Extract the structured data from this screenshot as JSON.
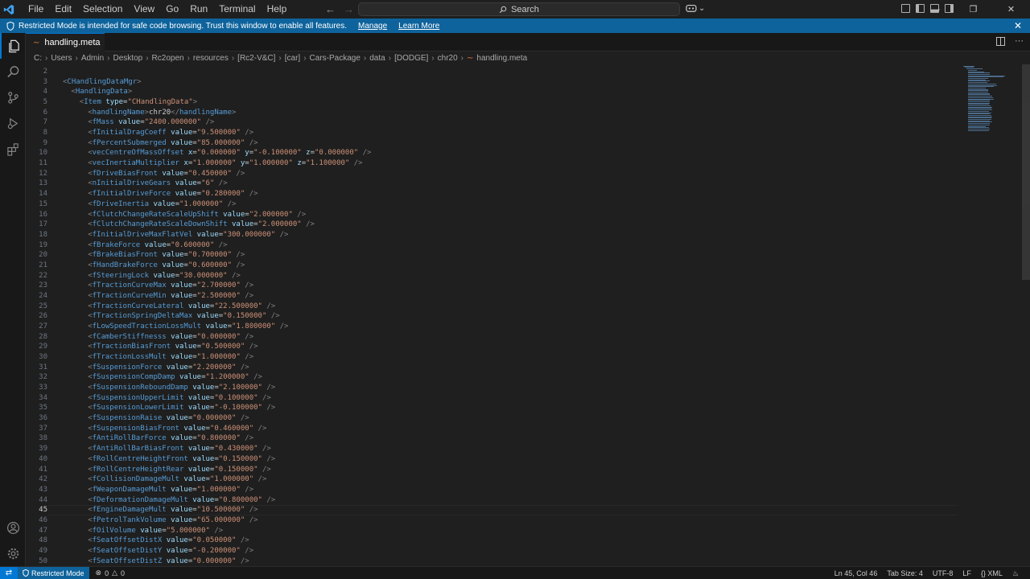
{
  "titlebar": {
    "menu": [
      "File",
      "Edit",
      "Selection",
      "View",
      "Go",
      "Run",
      "Terminal",
      "Help"
    ],
    "search_label": "Search"
  },
  "banner": {
    "message": "Restricted Mode is intended for safe code browsing. Trust this window to enable all features.",
    "manage": "Manage",
    "learn_more": "Learn More"
  },
  "tab": {
    "filename": "handling.meta"
  },
  "breadcrumb": [
    "C:",
    "Users",
    "Admin",
    "Desktop",
    "Rc2open",
    "resources",
    "[Rc2-V&C]",
    "[car]",
    "Cars-Package",
    "data",
    "[DODGE]",
    "chr20",
    "handling.meta"
  ],
  "editor": {
    "active_line": 45,
    "lines": [
      {
        "n": "2",
        "indent": 0,
        "kind": "blank"
      },
      {
        "n": "3",
        "indent": 0,
        "kind": "open",
        "tag": "CHandlingDataMgr"
      },
      {
        "n": "4",
        "indent": 1,
        "kind": "open",
        "tag": "HandlingData"
      },
      {
        "n": "5",
        "indent": 2,
        "kind": "open",
        "tag": "Item",
        "attrs": [
          [
            "type",
            "CHandlingData"
          ]
        ]
      },
      {
        "n": "6",
        "indent": 3,
        "kind": "text",
        "tag": "handlingName",
        "text": "chr20"
      },
      {
        "n": "7",
        "indent": 3,
        "kind": "self",
        "tag": "fMass",
        "attrs": [
          [
            "value",
            "2400.000000"
          ]
        ]
      },
      {
        "n": "8",
        "indent": 3,
        "kind": "self",
        "tag": "fInitialDragCoeff",
        "attrs": [
          [
            "value",
            "9.500000"
          ]
        ]
      },
      {
        "n": "9",
        "indent": 3,
        "kind": "self",
        "tag": "fPercentSubmerged",
        "attrs": [
          [
            "value",
            "85.000000"
          ]
        ]
      },
      {
        "n": "10",
        "indent": 3,
        "kind": "self",
        "tag": "vecCentreOfMassOffset",
        "attrs": [
          [
            "x",
            "0.000000"
          ],
          [
            "y",
            "-0.100000"
          ],
          [
            "z",
            "0.000000"
          ]
        ]
      },
      {
        "n": "11",
        "indent": 3,
        "kind": "self",
        "tag": "vecInertiaMultiplier",
        "attrs": [
          [
            "x",
            "1.000000"
          ],
          [
            "y",
            "1.000000"
          ],
          [
            "z",
            "1.100000"
          ]
        ]
      },
      {
        "n": "12",
        "indent": 3,
        "kind": "self",
        "tag": "fDriveBiasFront",
        "attrs": [
          [
            "value",
            "0.450000"
          ]
        ]
      },
      {
        "n": "13",
        "indent": 3,
        "kind": "self",
        "tag": "nInitialDriveGears",
        "attrs": [
          [
            "value",
            "6"
          ]
        ]
      },
      {
        "n": "14",
        "indent": 3,
        "kind": "self",
        "tag": "fInitialDriveForce",
        "attrs": [
          [
            "value",
            "0.280000"
          ]
        ]
      },
      {
        "n": "15",
        "indent": 3,
        "kind": "self",
        "tag": "fDriveInertia",
        "attrs": [
          [
            "value",
            "1.000000"
          ]
        ]
      },
      {
        "n": "16",
        "indent": 3,
        "kind": "self",
        "tag": "fClutchChangeRateScaleUpShift",
        "attrs": [
          [
            "value",
            "2.000000"
          ]
        ]
      },
      {
        "n": "17",
        "indent": 3,
        "kind": "self",
        "tag": "fClutchChangeRateScaleDownShift",
        "attrs": [
          [
            "value",
            "2.000000"
          ]
        ]
      },
      {
        "n": "18",
        "indent": 3,
        "kind": "self",
        "tag": "fInitialDriveMaxFlatVel",
        "attrs": [
          [
            "value",
            "300.000000"
          ]
        ]
      },
      {
        "n": "19",
        "indent": 3,
        "kind": "self",
        "tag": "fBrakeForce",
        "attrs": [
          [
            "value",
            "0.600000"
          ]
        ]
      },
      {
        "n": "20",
        "indent": 3,
        "kind": "self",
        "tag": "fBrakeBiasFront",
        "attrs": [
          [
            "value",
            "0.700000"
          ]
        ]
      },
      {
        "n": "21",
        "indent": 3,
        "kind": "self",
        "tag": "fHandBrakeForce",
        "attrs": [
          [
            "value",
            "0.600000"
          ]
        ]
      },
      {
        "n": "22",
        "indent": 3,
        "kind": "self",
        "tag": "fSteeringLock",
        "attrs": [
          [
            "value",
            "30.000000"
          ]
        ]
      },
      {
        "n": "23",
        "indent": 3,
        "kind": "self",
        "tag": "fTractionCurveMax",
        "attrs": [
          [
            "value",
            "2.700000"
          ]
        ]
      },
      {
        "n": "24",
        "indent": 3,
        "kind": "self",
        "tag": "fTractionCurveMin",
        "attrs": [
          [
            "value",
            "2.500000"
          ]
        ]
      },
      {
        "n": "25",
        "indent": 3,
        "kind": "self",
        "tag": "fTractionCurveLateral",
        "attrs": [
          [
            "value",
            "22.500000"
          ]
        ]
      },
      {
        "n": "26",
        "indent": 3,
        "kind": "self",
        "tag": "fTractionSpringDeltaMax",
        "attrs": [
          [
            "value",
            "0.150000"
          ]
        ]
      },
      {
        "n": "27",
        "indent": 3,
        "kind": "self",
        "tag": "fLowSpeedTractionLossMult",
        "attrs": [
          [
            "value",
            "1.800000"
          ]
        ]
      },
      {
        "n": "28",
        "indent": 3,
        "kind": "self",
        "tag": "fCamberStiffnesss",
        "attrs": [
          [
            "value",
            "0.000000"
          ]
        ]
      },
      {
        "n": "29",
        "indent": 3,
        "kind": "self",
        "tag": "fTractionBiasFront",
        "attrs": [
          [
            "value",
            "0.500000"
          ]
        ]
      },
      {
        "n": "30",
        "indent": 3,
        "kind": "self",
        "tag": "fTractionLossMult",
        "attrs": [
          [
            "value",
            "1.000000"
          ]
        ]
      },
      {
        "n": "31",
        "indent": 3,
        "kind": "self",
        "tag": "fSuspensionForce",
        "attrs": [
          [
            "value",
            "2.200000"
          ]
        ]
      },
      {
        "n": "32",
        "indent": 3,
        "kind": "self",
        "tag": "fSuspensionCompDamp",
        "attrs": [
          [
            "value",
            "1.200000"
          ]
        ]
      },
      {
        "n": "33",
        "indent": 3,
        "kind": "self",
        "tag": "fSuspensionReboundDamp",
        "attrs": [
          [
            "value",
            "2.100000"
          ]
        ]
      },
      {
        "n": "34",
        "indent": 3,
        "kind": "self",
        "tag": "fSuspensionUpperLimit",
        "attrs": [
          [
            "value",
            "0.100000"
          ]
        ]
      },
      {
        "n": "35",
        "indent": 3,
        "kind": "self",
        "tag": "fSuspensionLowerLimit",
        "attrs": [
          [
            "value",
            "-0.100000"
          ]
        ]
      },
      {
        "n": "36",
        "indent": 3,
        "kind": "self",
        "tag": "fSuspensionRaise",
        "attrs": [
          [
            "value",
            "0.000000"
          ]
        ]
      },
      {
        "n": "37",
        "indent": 3,
        "kind": "self",
        "tag": "fSuspensionBiasFront",
        "attrs": [
          [
            "value",
            "0.460000"
          ]
        ]
      },
      {
        "n": "38",
        "indent": 3,
        "kind": "self",
        "tag": "fAntiRollBarForce",
        "attrs": [
          [
            "value",
            "0.800000"
          ]
        ]
      },
      {
        "n": "39",
        "indent": 3,
        "kind": "self",
        "tag": "fAntiRollBarBiasFront",
        "attrs": [
          [
            "value",
            "0.430000"
          ]
        ]
      },
      {
        "n": "40",
        "indent": 3,
        "kind": "self",
        "tag": "fRollCentreHeightFront",
        "attrs": [
          [
            "value",
            "0.150000"
          ]
        ]
      },
      {
        "n": "41",
        "indent": 3,
        "kind": "self",
        "tag": "fRollCentreHeightRear",
        "attrs": [
          [
            "value",
            "0.150000"
          ]
        ]
      },
      {
        "n": "42",
        "indent": 3,
        "kind": "self",
        "tag": "fCollisionDamageMult",
        "attrs": [
          [
            "value",
            "1.000000"
          ]
        ]
      },
      {
        "n": "43",
        "indent": 3,
        "kind": "self",
        "tag": "fWeaponDamageMult",
        "attrs": [
          [
            "value",
            "1.000000"
          ]
        ]
      },
      {
        "n": "44",
        "indent": 3,
        "kind": "self",
        "tag": "fDeformationDamageMult",
        "attrs": [
          [
            "value",
            "0.800000"
          ]
        ]
      },
      {
        "n": "45",
        "indent": 3,
        "kind": "self",
        "tag": "fEngineDamageMult",
        "attrs": [
          [
            "value",
            "10.500000"
          ]
        ]
      },
      {
        "n": "46",
        "indent": 3,
        "kind": "self",
        "tag": "fPetrolTankVolume",
        "attrs": [
          [
            "value",
            "65.000000"
          ]
        ]
      },
      {
        "n": "47",
        "indent": 3,
        "kind": "self",
        "tag": "fOilVolume",
        "attrs": [
          [
            "value",
            "5.000000"
          ]
        ]
      },
      {
        "n": "48",
        "indent": 3,
        "kind": "self",
        "tag": "fSeatOffsetDistX",
        "attrs": [
          [
            "value",
            "0.050000"
          ]
        ]
      },
      {
        "n": "49",
        "indent": 3,
        "kind": "self",
        "tag": "fSeatOffsetDistY",
        "attrs": [
          [
            "value",
            "-0.200000"
          ]
        ]
      },
      {
        "n": "50",
        "indent": 3,
        "kind": "self",
        "tag": "fSeatOffsetDistZ",
        "attrs": [
          [
            "value",
            "0.000000"
          ]
        ]
      }
    ]
  },
  "statusbar": {
    "restricted": "Restricted Mode",
    "errors": "0",
    "warnings": "0",
    "position": "Ln 45, Col 46",
    "tab_size": "Tab Size: 4",
    "encoding": "UTF-8",
    "eol": "LF",
    "language": "XML"
  },
  "colors": {
    "accent": "#0078d4",
    "banner": "#0e639c",
    "tag": "#569cd6",
    "attr": "#9cdcfe",
    "string": "#ce9178"
  },
  "icons": [
    "vscode-logo-icon",
    "arrow-left-icon",
    "arrow-right-icon",
    "search-icon",
    "copilot-icon",
    "files-icon",
    "search-icon",
    "source-control-icon",
    "run-debug-icon",
    "extensions-icon",
    "account-icon",
    "settings-gear-icon",
    "shield-icon",
    "close-icon",
    "split-editor-icon",
    "more-icon",
    "xml-file-icon",
    "remote-icon",
    "bell-icon"
  ]
}
